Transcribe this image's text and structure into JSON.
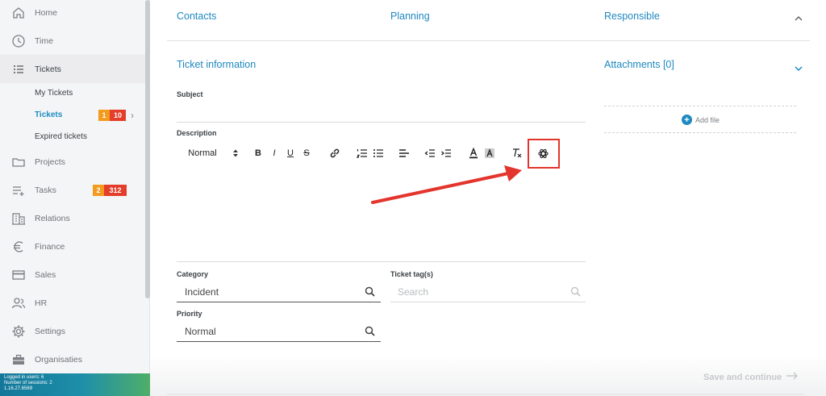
{
  "sidebar": {
    "items": [
      {
        "label": "Home",
        "icon": "home-icon"
      },
      {
        "label": "Time",
        "icon": "clock-icon"
      },
      {
        "label": "Tickets",
        "icon": "list-icon"
      },
      {
        "label": "Projects",
        "icon": "folder-icon"
      },
      {
        "label": "Tasks",
        "icon": "task-list-icon"
      },
      {
        "label": "Relations",
        "icon": "building-icon"
      },
      {
        "label": "Finance",
        "icon": "euro-icon"
      },
      {
        "label": "Sales",
        "icon": "card-icon"
      },
      {
        "label": "HR",
        "icon": "people-icon"
      },
      {
        "label": "Settings",
        "icon": "gear-icon"
      },
      {
        "label": "Organisaties",
        "icon": "briefcase-icon"
      }
    ],
    "tickets_sub": [
      {
        "label": "My Tickets"
      },
      {
        "label": "Tickets",
        "badge_orange": "1",
        "badge_red": "10"
      },
      {
        "label": "Expired tickets"
      }
    ],
    "tasks_badge_orange": "2",
    "tasks_badge_red": "312",
    "status": {
      "line1": "Logged in users: 6",
      "line2": "Number of sessions: 2",
      "line3": "1.16.27.6569"
    }
  },
  "main": {
    "top_headers": {
      "contacts": "Contacts",
      "planning": "Planning",
      "responsible": "Responsible"
    },
    "ticket_info_header": "Ticket information",
    "attachments_header": "Attachments [0]",
    "add_file_label": "Add file",
    "subject_label": "Subject",
    "description_label": "Description",
    "toolbar": {
      "format_select": "Normal",
      "bold": "B",
      "italic": "I",
      "underline": "U",
      "strike": "S"
    },
    "category_label": "Category",
    "category_value": "Incident",
    "tags_label": "Ticket tag(s)",
    "tags_placeholder": "Search",
    "priority_label": "Priority",
    "priority_value": "Normal",
    "save_label": "Save and continue"
  },
  "colors": {
    "accent": "#1e88c0",
    "badge_orange": "#f39b1f",
    "badge_red": "#e43e2b",
    "annotation_red": "#e3352d"
  }
}
